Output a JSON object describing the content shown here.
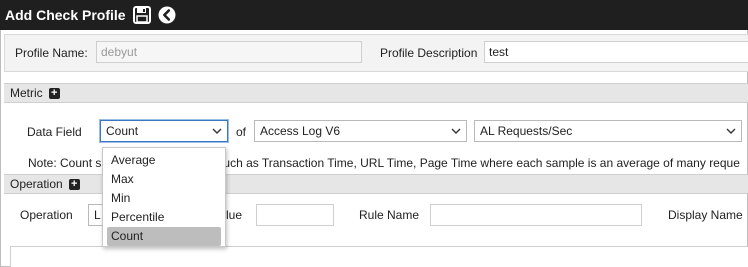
{
  "header": {
    "title": "Add Check Profile",
    "save_icon": "save-icon",
    "back_icon": "back-circle-icon"
  },
  "profile": {
    "name_label": "Profile Name:",
    "name_value": "debyut",
    "description_label": "Profile Description",
    "description_value": "test"
  },
  "metric": {
    "section_label": "Metric",
    "data_field_label": "Data Field",
    "data_field_value": "Count",
    "of_label": "of",
    "source_value": "Access Log V6",
    "measure_value": "AL Requests/Sec",
    "note_text": "Note: Count sh                            es such as Transaction Time, URL Time, Page Time where each sample is an average of many reque",
    "dropdown_options": [
      "Average",
      "Max",
      "Min",
      "Percentile",
      "Count"
    ],
    "dropdown_selected": "Count"
  },
  "operation": {
    "section_label": "Operation",
    "operation_label": "Operation",
    "operation_value_partial": "L",
    "value_label_partial": "lue",
    "rule_name_label": "Rule Name",
    "display_name_label": "Display Name"
  },
  "colors": {
    "titlebar": "#1f1f1f",
    "section_header": "#e6e6e6",
    "focus": "#3b78c4"
  }
}
